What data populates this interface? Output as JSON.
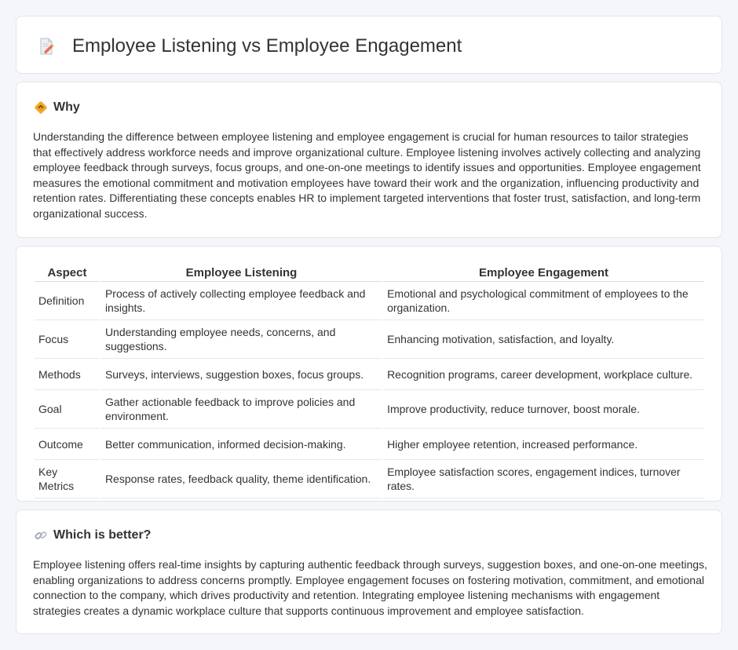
{
  "header": {
    "title": "Employee Listening vs Employee Engagement",
    "icon": "document-pencil-icon"
  },
  "why": {
    "icon": "diamond-sign-icon",
    "title": "Why",
    "text": "Understanding the difference between employee listening and employee engagement is crucial for human resources to tailor strategies that effectively address workforce needs and improve organizational culture. Employee listening involves actively collecting and analyzing employee feedback through surveys, focus groups, and one-on-one meetings to identify issues and opportunities. Employee engagement measures the emotional commitment and motivation employees have toward their work and the organization, influencing productivity and retention rates. Differentiating these concepts enables HR to implement targeted interventions that foster trust, satisfaction, and long-term organizational success."
  },
  "table": {
    "headers": [
      "Aspect",
      "Employee Listening",
      "Employee Engagement"
    ],
    "rows": [
      [
        "Definition",
        "Process of actively collecting employee feedback and insights.",
        "Emotional and psychological commitment of employees to the organization."
      ],
      [
        "Focus",
        "Understanding employee needs, concerns, and suggestions.",
        "Enhancing motivation, satisfaction, and loyalty."
      ],
      [
        "Methods",
        "Surveys, interviews, suggestion boxes, focus groups.",
        "Recognition programs, career development, workplace culture."
      ],
      [
        "Goal",
        "Gather actionable feedback to improve policies and environment.",
        "Improve productivity, reduce turnover, boost morale."
      ],
      [
        "Outcome",
        "Better communication, informed decision-making.",
        "Higher employee retention, increased performance."
      ],
      [
        "Key Metrics",
        "Response rates, feedback quality, theme identification.",
        "Employee satisfaction scores, engagement indices, turnover rates."
      ]
    ]
  },
  "better": {
    "icon": "link-icon",
    "title": "Which is better?",
    "text": "Employee listening offers real-time insights by capturing authentic feedback through surveys, suggestion boxes, and one-on-one meetings, enabling organizations to address concerns promptly. Employee engagement focuses on fostering motivation, commitment, and emotional connection to the company, which drives productivity and retention. Integrating employee listening mechanisms with engagement strategies creates a dynamic workplace culture that supports continuous improvement and employee satisfaction."
  }
}
